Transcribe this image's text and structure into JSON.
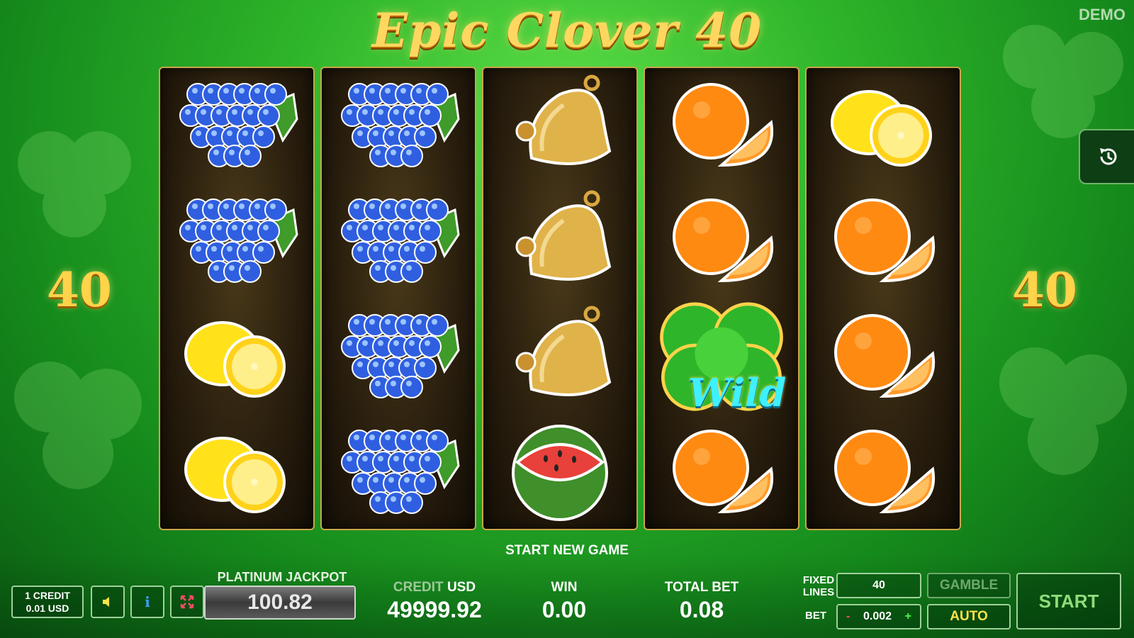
{
  "game": {
    "title": "Epic Clover 40",
    "mode_badge": "DEMO",
    "lines_left": "40",
    "lines_right": "40",
    "status_message": "START NEW GAME"
  },
  "reels": [
    {
      "symbols": [
        "grapes",
        "grapes",
        "lemon",
        "lemon"
      ]
    },
    {
      "symbols": [
        "grapes",
        "grapes",
        "grapes",
        "grapes"
      ]
    },
    {
      "symbols": [
        "bell",
        "bell",
        "bell",
        "watermelon"
      ]
    },
    {
      "symbols": [
        "orange",
        "orange",
        "wild-clover",
        "orange"
      ]
    },
    {
      "symbols": [
        "lemon",
        "orange",
        "orange",
        "orange"
      ]
    }
  ],
  "wild_label": "Wild",
  "controls": {
    "credit_denomination_line1": "1 CREDIT",
    "credit_denomination_line2": "0.01 USD",
    "sound_icon": "speaker-icon",
    "info_label": "i",
    "fullscreen_icon": "fullscreen-icon",
    "jackpot_label": "PLATINUM JACKPOT",
    "jackpot_value": "100.82",
    "credit_label_dim": "CREDIT",
    "credit_label_currency": "USD",
    "credit_value": "49999.92",
    "win_label": "WIN",
    "win_value": "0.00",
    "total_bet_label": "TOTAL BET",
    "total_bet_value": "0.08",
    "fixed_lines_label_1": "FIXED",
    "fixed_lines_label_2": "LINES",
    "fixed_lines_value": "40",
    "bet_label": "BET",
    "bet_minus": "-",
    "bet_value": "0.002",
    "bet_plus": "+",
    "gamble_label": "GAMBLE",
    "auto_label": "AUTO",
    "start_label": "START"
  },
  "colors": {
    "background_green": "#2fb52a",
    "gold": "#ffd760",
    "auto_yellow": "#ffe34a",
    "reel_border": "#c9a64a"
  }
}
